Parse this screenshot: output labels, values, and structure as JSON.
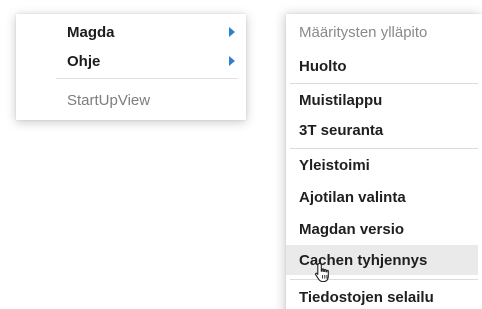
{
  "left_menu": {
    "items": [
      {
        "label": "Magda",
        "has_submenu": true
      },
      {
        "label": "Ohje",
        "has_submenu": true
      },
      {
        "label": "StartUpView",
        "has_submenu": false,
        "disabled": true
      }
    ]
  },
  "submenu": {
    "items": [
      {
        "label": "Määritysten ylläpito",
        "disabled": true
      },
      {
        "label": "Huolto"
      },
      {
        "label": "Muistilappu"
      },
      {
        "label": "3T seuranta"
      },
      {
        "label": "Yleistoimi"
      },
      {
        "label": "Ajotilan valinta"
      },
      {
        "label": "Magdan versio"
      },
      {
        "label": "Cachen tyhjennys",
        "hovered": true
      },
      {
        "label": "Tiedostojen selailu"
      }
    ]
  },
  "colors": {
    "arrow": "#2f7fd1",
    "hover_background": "#eaeaea",
    "text": "#1f1f1f",
    "disabled_text": "#8a8a8a"
  }
}
